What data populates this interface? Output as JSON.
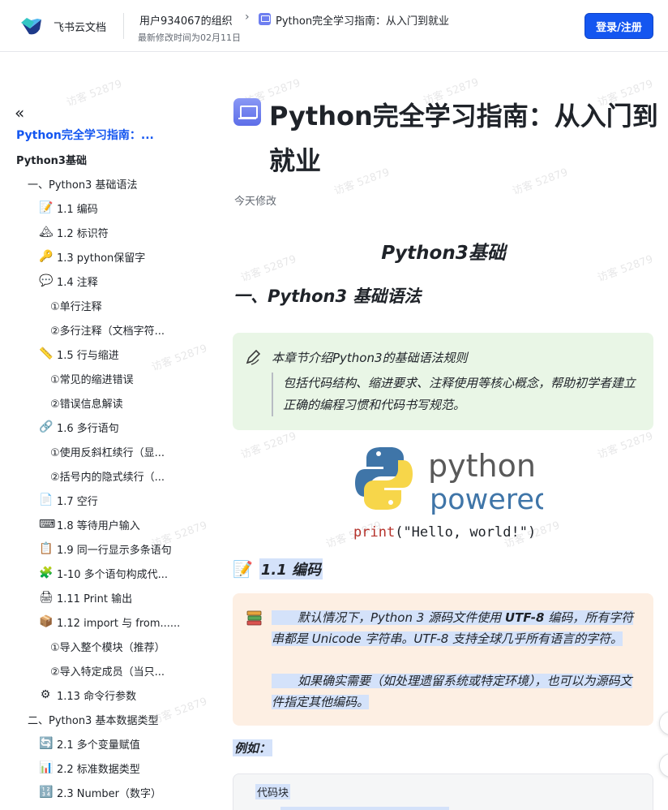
{
  "header": {
    "brand": "飞书云文档",
    "org": "用户934067的组织",
    "sep": "›",
    "doc_title": "Python完全学习指南：从入门到就业",
    "modified": "最新修改时间为02月11日",
    "login": "登录/注册"
  },
  "sidebar": {
    "collapse": "«",
    "items": [
      {
        "label": "Python完全学习指南：...",
        "icon": ""
      },
      {
        "label": "Python3基础",
        "icon": ""
      },
      {
        "label": "一、Python3 基础语法",
        "icon": ""
      },
      {
        "label": "1.1 编码",
        "icon": "📝"
      },
      {
        "label": "1.2 标识符",
        "icon": "🏔"
      },
      {
        "label": "1.3 python保留字",
        "icon": "🔑"
      },
      {
        "label": "1.4 注释",
        "icon": "💬"
      },
      {
        "label": "①单行注释",
        "icon": ""
      },
      {
        "label": "②多行注释（文档字符...",
        "icon": ""
      },
      {
        "label": "1.5 行与缩进",
        "icon": "📏"
      },
      {
        "label": "①常见的缩进错误",
        "icon": ""
      },
      {
        "label": "②错误信息解读",
        "icon": ""
      },
      {
        "label": "1.6 多行语句",
        "icon": "🔗"
      },
      {
        "label": "①使用反斜杠续行（显...",
        "icon": ""
      },
      {
        "label": "②括号内的隐式续行（...",
        "icon": ""
      },
      {
        "label": "1.7 空行",
        "icon": "📄"
      },
      {
        "label": "1.8 等待用户输入",
        "icon": "⌨"
      },
      {
        "label": "1.9 同一行显示多条语句",
        "icon": "📋"
      },
      {
        "label": "1-10 多个语句构成代...",
        "icon": "🧩"
      },
      {
        "label": "1.11 Print 输出",
        "icon": "🖨"
      },
      {
        "label": "1.12 import 与 from......",
        "icon": "📦"
      },
      {
        "label": "①导入整个模块（推荐）",
        "icon": ""
      },
      {
        "label": "②导入特定成员（当只...",
        "icon": ""
      },
      {
        "label": "1.13 命令行参数",
        "icon": "⚙"
      },
      {
        "label": "二、Python3 基本数据类型",
        "icon": ""
      },
      {
        "label": "2.1 多个变量赋值",
        "icon": "🔄"
      },
      {
        "label": "2.2 标准数据类型",
        "icon": "📊"
      },
      {
        "label": "2.3 Number（数字）",
        "icon": "🔢"
      }
    ]
  },
  "main": {
    "title": "Python完全学习指南：从入门到就业",
    "today": "今天修改",
    "section_title": "Python3基础",
    "heading1": "一、Python3 基础语法",
    "callout1": {
      "title": "本章节介绍Python3的基础语法规则",
      "quote": "包括代码结构、缩进要求、注释使用等核心概念，帮助初学者建立正确的编程习惯和代码书写规范。"
    },
    "logo": {
      "word1": "python",
      "word2": "powered",
      "code_fn": "print",
      "code_arg": "\"Hello, world!\"",
      "code_open": "(",
      "code_close": ")"
    },
    "heading2": "1.1 编码",
    "callout2": {
      "p1_a": "默认情况下，Python 3 源码文件使用 ",
      "p1_b": "UTF-8",
      "p1_c": " 编码，所有字符串都是 Unicode 字符串。UTF-8 支持全球几乎所有语言的字符。",
      "p2": "如果确实需要（如处理遗留系统或特定环境），也可以为源码文件指定其他编码。"
    },
    "example": "例如：",
    "code_label": "代码块"
  },
  "watermark": "访客 52879",
  "colors": {
    "accent": "#1456f0",
    "callout_green": "#e9f6e6",
    "callout_orange": "#fdefe3",
    "highlight": "#d4e2fa",
    "python_blue": "#3f75a8",
    "python_yellow": "#f7d64a",
    "hello_red": "#b5322b"
  }
}
